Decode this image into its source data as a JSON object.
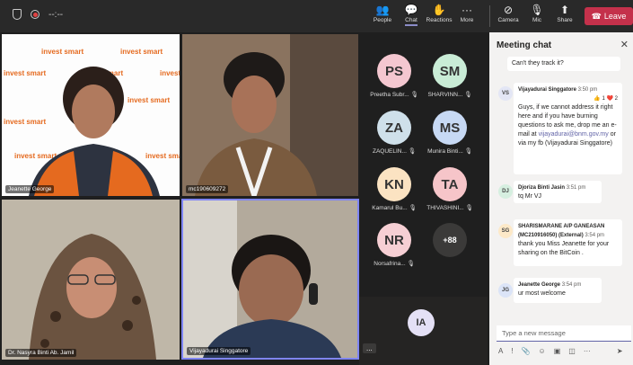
{
  "top": {
    "timer": "--:--",
    "buttons": [
      "People",
      "Chat",
      "Reactions",
      "More",
      "Camera",
      "Mic",
      "Share"
    ],
    "leave": "Leave"
  },
  "tiles": [
    {
      "name": "Jeanette George"
    },
    {
      "name": "mc190609272"
    },
    {
      "name": "Dr. Nasyra Binti Ab. Jamil"
    },
    {
      "name": "Vijayadurai Singgatore"
    }
  ],
  "brand": "Invest Smart",
  "participants": [
    {
      "initials": "PS",
      "name": "Preetha Subr...",
      "color": "#f4c7d0"
    },
    {
      "initials": "SM",
      "name": "SHARVINN...",
      "color": "#c9ecd6"
    },
    {
      "initials": "ZA",
      "name": "ZAQUELIN...",
      "color": "#cfe0ea"
    },
    {
      "initials": "MS",
      "name": "Munira Binti...",
      "color": "#c7d9f4"
    },
    {
      "initials": "KN",
      "name": "Kamarul Bu...",
      "color": "#fbe3c2"
    },
    {
      "initials": "TA",
      "name": "THIVASHINI...",
      "color": "#f6c5c9"
    },
    {
      "initials": "NR",
      "name": "Norsafrina...",
      "color": "#f6cfd4"
    }
  ],
  "overflow_count": "+88",
  "self_avatar": "IA",
  "more_dots": "...",
  "chat": {
    "title": "Meeting chat",
    "messages": [
      {
        "text": "Can't they track it?"
      },
      {
        "initials": "VS",
        "author": "Vijayadurai Singgatore",
        "time": "3:50 pm",
        "reactions": "👍 1 ❤️ 2",
        "text1": "Guys, if we cannot address it right here and if you have burning questions to ask me, drop me an e-mail at",
        "email": "vijayadurai@bnm.gov.my",
        "text2": "or via my fb (Vijayadurai Singgatore)"
      },
      {
        "initials": "DJ",
        "author": "Djoriza Binti Jasin",
        "time": "3:51 pm",
        "text": "tq Mr VJ"
      },
      {
        "initials": "SG",
        "author": "SHARISMARANE A/P GANEASAN (MC210916050) (External)",
        "time": "3:54 pm",
        "text": "thank you Miss Jeanette for your sharing on the BitCoin ."
      },
      {
        "initials": "JG",
        "author": "Jeanette George",
        "time": "3:54 pm",
        "text": "ur most welcome"
      }
    ],
    "placeholder": "Type a new message"
  }
}
